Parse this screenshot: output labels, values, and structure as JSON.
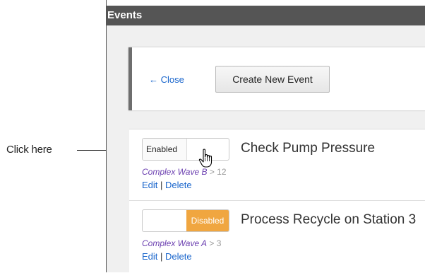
{
  "annotation": {
    "label": "Click here"
  },
  "window": {
    "title": "Events"
  },
  "toolbar": {
    "close_label": "← Close",
    "create_label": "Create New Event"
  },
  "events": [
    {
      "status": "Enabled",
      "name": "Check Pump Pressure",
      "wave": "Complex Wave B",
      "separator": " > ",
      "count": "12",
      "edit_label": "Edit",
      "pipe": " | ",
      "delete_label": "Delete"
    },
    {
      "status": "Disabled",
      "name": "Process Recycle on Station 3",
      "wave": "Complex Wave A",
      "separator": " > ",
      "count": "3",
      "edit_label": "Edit",
      "pipe": " | ",
      "delete_label": "Delete"
    }
  ],
  "colors": {
    "titlebar": "#555555",
    "link": "#1a66cc",
    "wave": "#6b3fb0",
    "disabled": "#f0a640"
  },
  "icons": {
    "cursor": "hand-pointer-icon"
  }
}
